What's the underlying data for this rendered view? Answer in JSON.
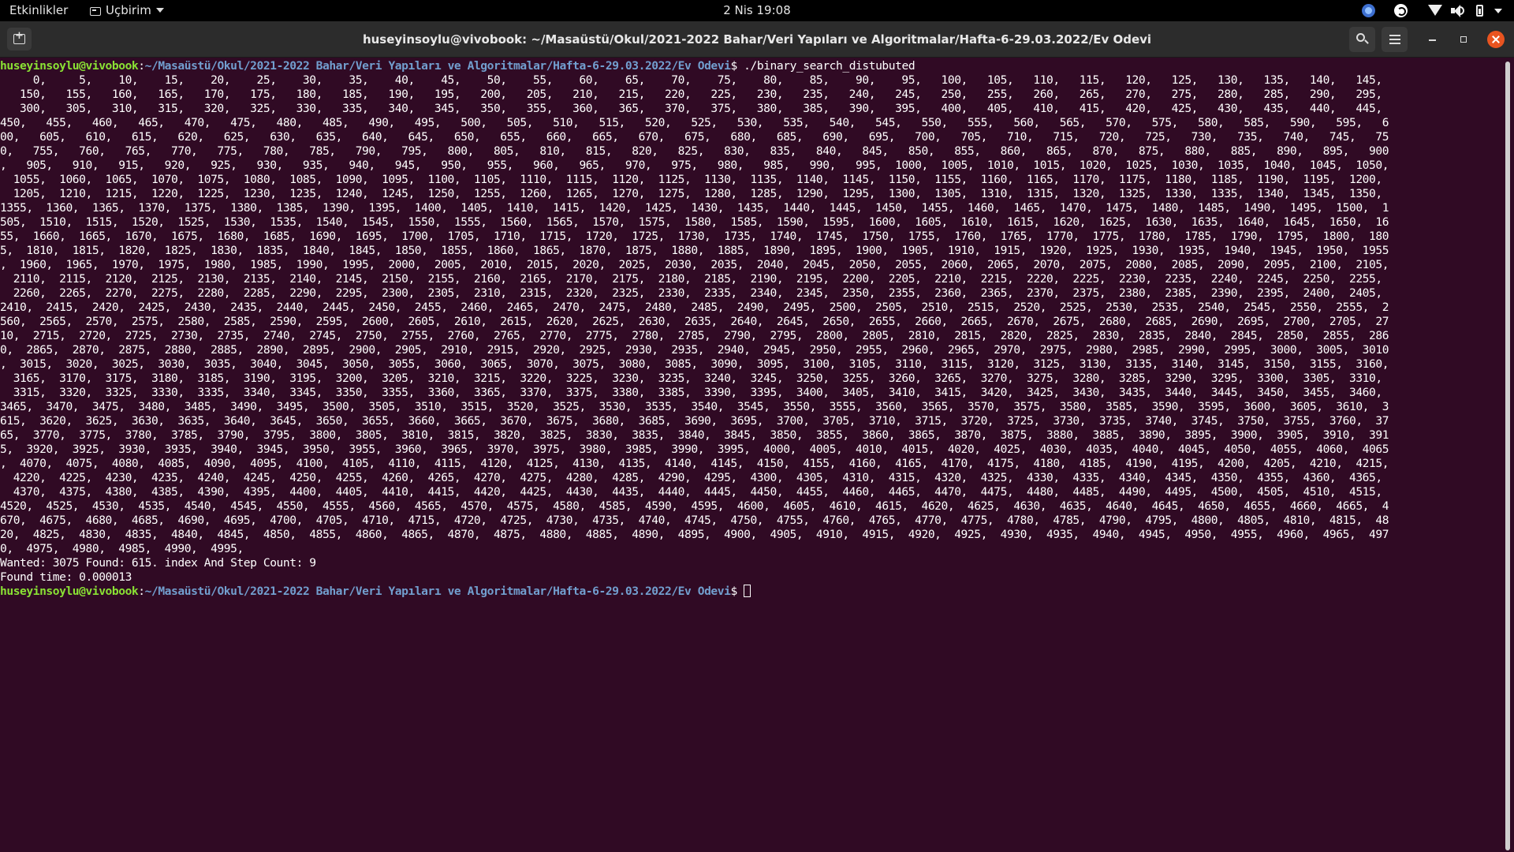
{
  "topbar": {
    "activities": "Etkinlikler",
    "app_menu": "Uçbirim",
    "clock": "2 Nis  19:08",
    "tray_icons": [
      "app-tray-icon",
      "app-tray-icon-2",
      "wifi-icon",
      "volume-icon",
      "battery-icon",
      "system-menu-caret-icon"
    ]
  },
  "window": {
    "title": "huseyinsoylu@vivobook: ~/Masaüstü/Okul/2021-2022 Bahar/Veri Yapıları ve Algoritmalar/Hafta-6-29.03.2022/Ev Odevi",
    "buttons": [
      "new-tab-icon",
      "search-icon",
      "hamburger-menu-icon",
      "minimize-icon",
      "maximize-icon",
      "close-icon"
    ]
  },
  "colors": {
    "terminal_bg": "#300a24",
    "prompt_user": "#8ae234",
    "prompt_path": "#729fcf",
    "close_button": "#e95420"
  },
  "terminal": {
    "prompt_user": "huseyinsoylu@vivobook",
    "prompt_path": "~/Masaüstü/Okul/2021-2022 Bahar/Veri Yapıları ve Algoritmalar/Hafta-6-29.03.2022/Ev Odevi",
    "command": " ./binary_search_distubuted",
    "output_lines": [
      "     0,     5,    10,    15,    20,    25,    30,    35,    40,    45,    50,    55,    60,    65,    70,    75,    80,    85,    90,    95,   100,   105,   110,   115,   120,   125,   130,   135,   140,   145,",
      "   150,   155,   160,   165,   170,   175,   180,   185,   190,   195,   200,   205,   210,   215,   220,   225,   230,   235,   240,   245,   250,   255,   260,   265,   270,   275,   280,   285,   290,   295,",
      "   300,   305,   310,   315,   320,   325,   330,   335,   340,   345,   350,   355,   360,   365,   370,   375,   380,   385,   390,   395,   400,   405,   410,   415,   420,   425,   430,   435,   440,   445,",
      "450,   455,   460,   465,   470,   475,   480,   485,   490,   495,   500,   505,   510,   515,   520,   525,   530,   535,   540,   545,   550,   555,   560,   565,   570,   575,   580,   585,   590,   595,   6",
      "00,   605,   610,   615,   620,   625,   630,   635,   640,   645,   650,   655,   660,   665,   670,   675,   680,   685,   690,   695,   700,   705,   710,   715,   720,   725,   730,   735,   740,   745,   75",
      "0,   755,   760,   765,   770,   775,   780,   785,   790,   795,   800,   805,   810,   815,   820,   825,   830,   835,   840,   845,   850,   855,   860,   865,   870,   875,   880,   885,   890,   895,   900",
      ",   905,   910,   915,   920,   925,   930,   935,   940,   945,   950,   955,   960,   965,   970,   975,   980,   985,   990,   995,  1000,  1005,  1010,  1015,  1020,  1025,  1030,  1035,  1040,  1045,  1050,",
      "  1055,  1060,  1065,  1070,  1075,  1080,  1085,  1090,  1095,  1100,  1105,  1110,  1115,  1120,  1125,  1130,  1135,  1140,  1145,  1150,  1155,  1160,  1165,  1170,  1175,  1180,  1185,  1190,  1195,  1200,",
      "  1205,  1210,  1215,  1220,  1225,  1230,  1235,  1240,  1245,  1250,  1255,  1260,  1265,  1270,  1275,  1280,  1285,  1290,  1295,  1300,  1305,  1310,  1315,  1320,  1325,  1330,  1335,  1340,  1345,  1350,",
      "1355,  1360,  1365,  1370,  1375,  1380,  1385,  1390,  1395,  1400,  1405,  1410,  1415,  1420,  1425,  1430,  1435,  1440,  1445,  1450,  1455,  1460,  1465,  1470,  1475,  1480,  1485,  1490,  1495,  1500,  1",
      "505,  1510,  1515,  1520,  1525,  1530,  1535,  1540,  1545,  1550,  1555,  1560,  1565,  1570,  1575,  1580,  1585,  1590,  1595,  1600,  1605,  1610,  1615,  1620,  1625,  1630,  1635,  1640,  1645,  1650,  16",
      "55,  1660,  1665,  1670,  1675,  1680,  1685,  1690,  1695,  1700,  1705,  1710,  1715,  1720,  1725,  1730,  1735,  1740,  1745,  1750,  1755,  1760,  1765,  1770,  1775,  1780,  1785,  1790,  1795,  1800,  180",
      "5,  1810,  1815,  1820,  1825,  1830,  1835,  1840,  1845,  1850,  1855,  1860,  1865,  1870,  1875,  1880,  1885,  1890,  1895,  1900,  1905,  1910,  1915,  1920,  1925,  1930,  1935,  1940,  1945,  1950,  1955",
      ",  1960,  1965,  1970,  1975,  1980,  1985,  1990,  1995,  2000,  2005,  2010,  2015,  2020,  2025,  2030,  2035,  2040,  2045,  2050,  2055,  2060,  2065,  2070,  2075,  2080,  2085,  2090,  2095,  2100,  2105,",
      "  2110,  2115,  2120,  2125,  2130,  2135,  2140,  2145,  2150,  2155,  2160,  2165,  2170,  2175,  2180,  2185,  2190,  2195,  2200,  2205,  2210,  2215,  2220,  2225,  2230,  2235,  2240,  2245,  2250,  2255,",
      "  2260,  2265,  2270,  2275,  2280,  2285,  2290,  2295,  2300,  2305,  2310,  2315,  2320,  2325,  2330,  2335,  2340,  2345,  2350,  2355,  2360,  2365,  2370,  2375,  2380,  2385,  2390,  2395,  2400,  2405,",
      "2410,  2415,  2420,  2425,  2430,  2435,  2440,  2445,  2450,  2455,  2460,  2465,  2470,  2475,  2480,  2485,  2490,  2495,  2500,  2505,  2510,  2515,  2520,  2525,  2530,  2535,  2540,  2545,  2550,  2555,  2",
      "560,  2565,  2570,  2575,  2580,  2585,  2590,  2595,  2600,  2605,  2610,  2615,  2620,  2625,  2630,  2635,  2640,  2645,  2650,  2655,  2660,  2665,  2670,  2675,  2680,  2685,  2690,  2695,  2700,  2705,  27",
      "10,  2715,  2720,  2725,  2730,  2735,  2740,  2745,  2750,  2755,  2760,  2765,  2770,  2775,  2780,  2785,  2790,  2795,  2800,  2805,  2810,  2815,  2820,  2825,  2830,  2835,  2840,  2845,  2850,  2855,  286",
      "0,  2865,  2870,  2875,  2880,  2885,  2890,  2895,  2900,  2905,  2910,  2915,  2920,  2925,  2930,  2935,  2940,  2945,  2950,  2955,  2960,  2965,  2970,  2975,  2980,  2985,  2990,  2995,  3000,  3005,  3010",
      ",  3015,  3020,  3025,  3030,  3035,  3040,  3045,  3050,  3055,  3060,  3065,  3070,  3075,  3080,  3085,  3090,  3095,  3100,  3105,  3110,  3115,  3120,  3125,  3130,  3135,  3140,  3145,  3150,  3155,  3160,",
      "  3165,  3170,  3175,  3180,  3185,  3190,  3195,  3200,  3205,  3210,  3215,  3220,  3225,  3230,  3235,  3240,  3245,  3250,  3255,  3260,  3265,  3270,  3275,  3280,  3285,  3290,  3295,  3300,  3305,  3310,",
      "  3315,  3320,  3325,  3330,  3335,  3340,  3345,  3350,  3355,  3360,  3365,  3370,  3375,  3380,  3385,  3390,  3395,  3400,  3405,  3410,  3415,  3420,  3425,  3430,  3435,  3440,  3445,  3450,  3455,  3460,",
      "3465,  3470,  3475,  3480,  3485,  3490,  3495,  3500,  3505,  3510,  3515,  3520,  3525,  3530,  3535,  3540,  3545,  3550,  3555,  3560,  3565,  3570,  3575,  3580,  3585,  3590,  3595,  3600,  3605,  3610,  3",
      "615,  3620,  3625,  3630,  3635,  3640,  3645,  3650,  3655,  3660,  3665,  3670,  3675,  3680,  3685,  3690,  3695,  3700,  3705,  3710,  3715,  3720,  3725,  3730,  3735,  3740,  3745,  3750,  3755,  3760,  37",
      "65,  3770,  3775,  3780,  3785,  3790,  3795,  3800,  3805,  3810,  3815,  3820,  3825,  3830,  3835,  3840,  3845,  3850,  3855,  3860,  3865,  3870,  3875,  3880,  3885,  3890,  3895,  3900,  3905,  3910,  391",
      "5,  3920,  3925,  3930,  3935,  3940,  3945,  3950,  3955,  3960,  3965,  3970,  3975,  3980,  3985,  3990,  3995,  4000,  4005,  4010,  4015,  4020,  4025,  4030,  4035,  4040,  4045,  4050,  4055,  4060,  4065",
      ",  4070,  4075,  4080,  4085,  4090,  4095,  4100,  4105,  4110,  4115,  4120,  4125,  4130,  4135,  4140,  4145,  4150,  4155,  4160,  4165,  4170,  4175,  4180,  4185,  4190,  4195,  4200,  4205,  4210,  4215,",
      "  4220,  4225,  4230,  4235,  4240,  4245,  4250,  4255,  4260,  4265,  4270,  4275,  4280,  4285,  4290,  4295,  4300,  4305,  4310,  4315,  4320,  4325,  4330,  4335,  4340,  4345,  4350,  4355,  4360,  4365,",
      "  4370,  4375,  4380,  4385,  4390,  4395,  4400,  4405,  4410,  4415,  4420,  4425,  4430,  4435,  4440,  4445,  4450,  4455,  4460,  4465,  4470,  4475,  4480,  4485,  4490,  4495,  4500,  4505,  4510,  4515,",
      "4520,  4525,  4530,  4535,  4540,  4545,  4550,  4555,  4560,  4565,  4570,  4575,  4580,  4585,  4590,  4595,  4600,  4605,  4610,  4615,  4620,  4625,  4630,  4635,  4640,  4645,  4650,  4655,  4660,  4665,  4",
      "670,  4675,  4680,  4685,  4690,  4695,  4700,  4705,  4710,  4715,  4720,  4725,  4730,  4735,  4740,  4745,  4750,  4755,  4760,  4765,  4770,  4775,  4780,  4785,  4790,  4795,  4800,  4805,  4810,  4815,  48",
      "20,  4825,  4830,  4835,  4840,  4845,  4850,  4855,  4860,  4865,  4870,  4875,  4880,  4885,  4890,  4895,  4900,  4905,  4910,  4915,  4920,  4925,  4930,  4935,  4940,  4945,  4950,  4955,  4960,  4965,  497",
      "0,  4975,  4980,  4985,  4990,  4995,",
      "Wanted: 3075 Found: 615. index And Step Count: 9",
      "Found time: 0.000013"
    ]
  }
}
